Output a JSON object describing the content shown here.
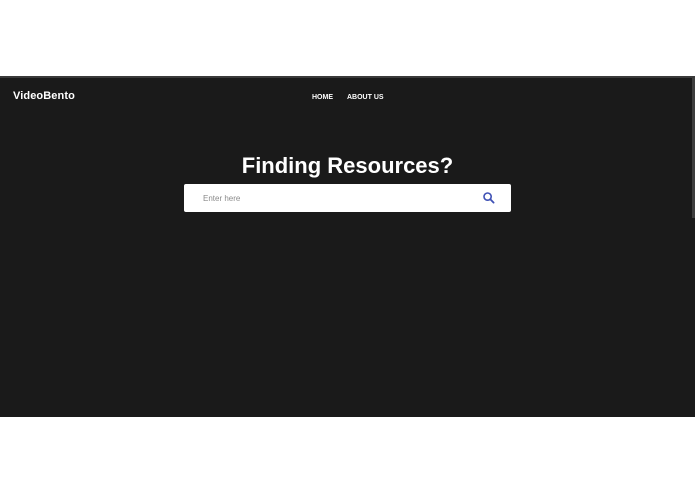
{
  "header": {
    "brand": "VideoBento",
    "nav": [
      {
        "label": "HOME"
      },
      {
        "label": "ABOUT US"
      }
    ]
  },
  "hero": {
    "title": "Finding Resources?"
  },
  "search": {
    "placeholder": "Enter here",
    "value": "",
    "icon": "search-icon"
  },
  "colors": {
    "background": "#1a1a1a",
    "text": "#ffffff",
    "search_icon": "#3f51b5"
  }
}
